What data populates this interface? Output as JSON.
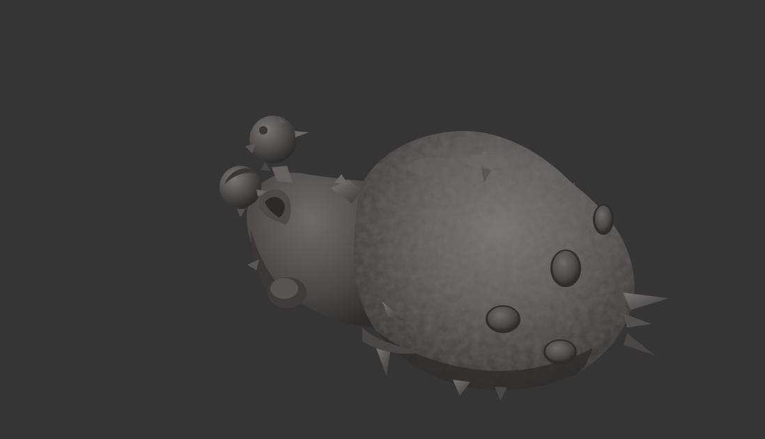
{
  "viewport": {
    "background_color": "#353535",
    "subject": "sculpted-creature-model",
    "material_color": "#5c5958"
  }
}
